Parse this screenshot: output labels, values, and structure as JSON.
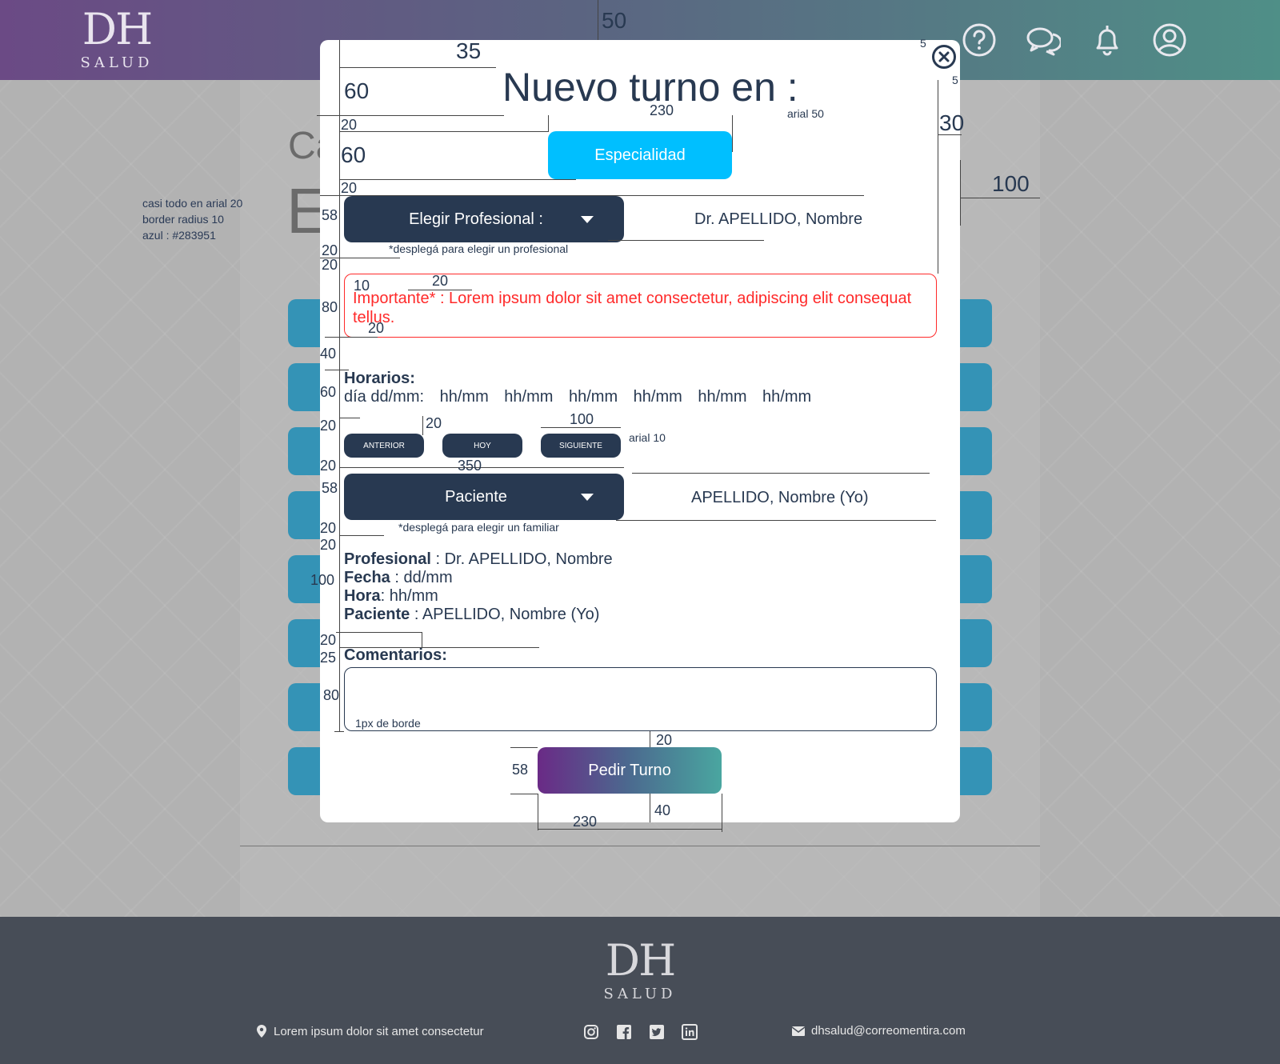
{
  "header": {
    "logo_dh": "DH",
    "logo_salud": "SALUD",
    "icons": [
      "help-icon",
      "chat-icon",
      "bell-icon",
      "user-icon"
    ],
    "gradient": [
      "#6b4a85",
      "#5b6481",
      "#4f8f87"
    ]
  },
  "background": {
    "title_fragment": "Ca",
    "title_fragment2": "E"
  },
  "notes": {
    "line1": "casi todo en arial 20",
    "line2": "border radius 10",
    "line3": "azul : #283951"
  },
  "modal": {
    "title": "Nuevo turno en :",
    "title_note": "arial 50",
    "especialidad_label": "Especialidad",
    "profesional_dropdown": "Elegir Profesional :",
    "profesional_value": "Dr.  APELLIDO, Nombre",
    "profesional_hint": "*desplegá para elegir un profesional",
    "warning_text": "Importante* : Lorem ipsum dolor sit amet consectetur, adipiscing elit consequat tellus.",
    "horarios_label": "Horarios:",
    "dia_label": "día dd/mm:",
    "slots": [
      "hh/mm",
      "hh/mm",
      "hh/mm",
      "hh/mm",
      "hh/mm",
      "hh/mm"
    ],
    "nav": {
      "anterior": "ANTERIOR",
      "hoy": "HOY",
      "siguiente": "SIGUIENTE",
      "note": "arial 10"
    },
    "paciente_dropdown": "Paciente",
    "paciente_value": "APELLIDO, Nombre (Yo)",
    "paciente_hint": "*desplegá para elegir un familiar",
    "summary": {
      "profesional_label": "Profesional",
      "profesional_value": " : Dr. APELLIDO, Nombre",
      "fecha_label": "Fecha",
      "fecha_value": " : dd/mm",
      "hora_label": "Hora",
      "hora_value": ": hh/mm",
      "paciente_label": "Paciente",
      "paciente_value": " : APELLIDO, Nombre (Yo)"
    },
    "comentarios_label": "Comentarios:",
    "comentarios_note": "1px de borde",
    "submit_label": "Pedir Turno",
    "colors": {
      "primary": "#283951",
      "especialidad": "#00bfff",
      "warning": "#ff2a2a"
    }
  },
  "annotations": {
    "a50": "50",
    "a35": "35",
    "a60a": "60",
    "a20a": "20",
    "a60b": "60",
    "a20b": "20",
    "a230top": "230",
    "a5a": "5",
    "a5b": "5",
    "a30": "30",
    "a100r": "100",
    "a58a": "58",
    "a20c": "20",
    "a20d": "20",
    "a10": "10",
    "a20e": "20",
    "a80": "80",
    "a20f": "20",
    "a40": "40",
    "a60c": "60",
    "a20g": "20",
    "a20h": "20",
    "a100b": "100",
    "a20i": "20",
    "a350": "350",
    "a58b": "58",
    "a20j": "20",
    "a20k": "20",
    "a100c": "100",
    "a20l": "20",
    "a25": "25",
    "a80b": "80",
    "a20m": "20",
    "a58c": "58",
    "a40b": "40",
    "a230b": "230"
  },
  "footer": {
    "logo_dh": "DH",
    "logo_salud": "SALUD",
    "address": "Lorem ipsum dolor sit amet consectetur",
    "email": "dhsalud@correomentira.com",
    "social": [
      "instagram-icon",
      "facebook-icon",
      "twitter-icon",
      "linkedin-icon"
    ]
  }
}
